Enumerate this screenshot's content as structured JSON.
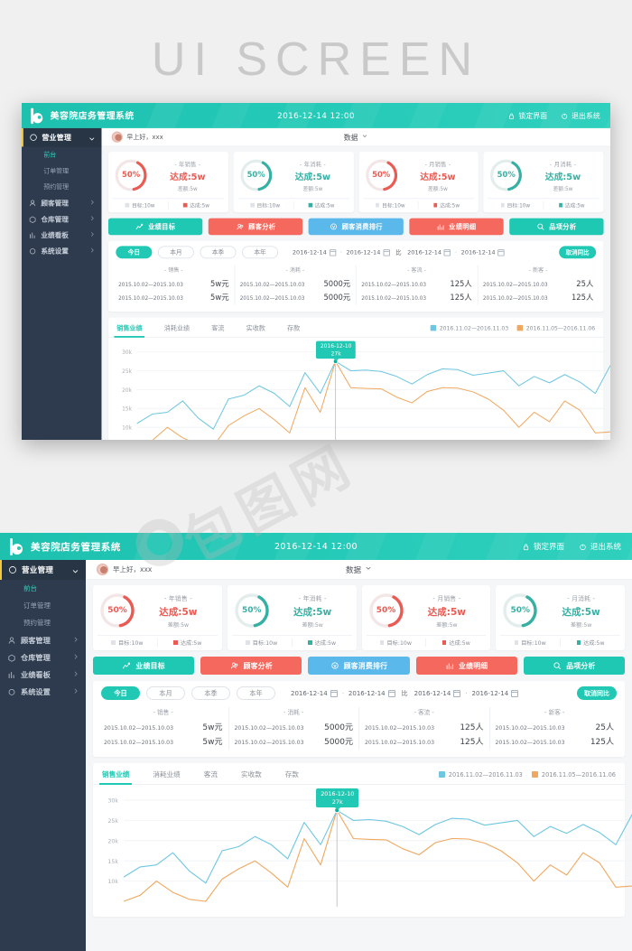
{
  "poster": {
    "heading": "UI SCREEN",
    "watermark": "包图网"
  },
  "topbar": {
    "app_title": "美容院店务管理系统",
    "clock": "2016-12-14 12:00",
    "lock_label": "锁定界面",
    "exit_label": "退出系统",
    "bg_color": "#23c8b6"
  },
  "sidebar": {
    "group": {
      "label": "营业管理",
      "icon": "compass-icon",
      "expanded": true,
      "accent": "#f5c842"
    },
    "sub_items": [
      {
        "label": "前台",
        "active": true
      },
      {
        "label": "订单管理",
        "active": false
      },
      {
        "label": "预约管理",
        "active": false
      }
    ],
    "items": [
      {
        "label": "顾客管理",
        "icon": "user-icon"
      },
      {
        "label": "仓库管理",
        "icon": "box-icon"
      },
      {
        "label": "业绩看板",
        "icon": "chart-icon"
      },
      {
        "label": "系统设置",
        "icon": "gear-icon"
      }
    ]
  },
  "greeting": {
    "text": "早上好，xxx",
    "data_dropdown": "数据"
  },
  "kpi_cards": [
    {
      "name": "- 年销售 -",
      "percent": "50%",
      "achieve_label": "达成:5w",
      "diff_label": "差额:5w",
      "target_label": "目标:10w",
      "foot_achieve_label": "达成:5w",
      "color": "#ea5b53",
      "ring_bg": "#f2e7e6",
      "value": 50
    },
    {
      "name": "- 年消耗 -",
      "percent": "50%",
      "achieve_label": "达成:5w",
      "diff_label": "差额:5w",
      "target_label": "目标:10w",
      "foot_achieve_label": "达成:5w",
      "color": "#37b0a4",
      "ring_bg": "#e3eeec",
      "value": 50
    },
    {
      "name": "- 月销售 -",
      "percent": "50%",
      "achieve_label": "达成:5w",
      "diff_label": "差额:5w",
      "target_label": "目标:10w",
      "foot_achieve_label": "达成:5w",
      "color": "#ea5b53",
      "ring_bg": "#f2e7e6",
      "value": 50
    },
    {
      "name": "- 月消耗 -",
      "percent": "50%",
      "achieve_label": "达成:5w",
      "diff_label": "差额:5w",
      "target_label": "目标:10w",
      "foot_achieve_label": "达成:5w",
      "color": "#37b0a4",
      "ring_bg": "#e3eeec",
      "value": 50
    }
  ],
  "action_buttons": [
    {
      "label": "业绩目标",
      "icon": "line-chart-icon",
      "color": "#1ec8b3"
    },
    {
      "label": "顾客分析",
      "icon": "people-icon",
      "color": "#f4685e"
    },
    {
      "label": "顾客消费排行",
      "icon": "medal-icon",
      "color": "#5bb8ea"
    },
    {
      "label": "业绩明细",
      "icon": "bar-chart-icon",
      "color": "#f4685e"
    },
    {
      "label": "品项分析",
      "icon": "search-icon",
      "color": "#1ec8b3"
    }
  ],
  "filters": {
    "pills": [
      {
        "label": "今日",
        "active": true
      },
      {
        "label": "本月",
        "active": false
      },
      {
        "label": "本季",
        "active": false
      },
      {
        "label": "本年",
        "active": false
      }
    ],
    "date_from_1": "2016-12-14",
    "date_to_1": "2016-12-14",
    "compare_label": "比",
    "date_from_2": "2016-12-14",
    "date_to_2": "2016-12-14",
    "separator": "·",
    "cancel_compare_label": "取消同比"
  },
  "stats": [
    {
      "title": "- 销售 -",
      "rows": [
        {
          "range": "2015.10.02—2015.10.03",
          "value": "5w元"
        },
        {
          "range": "2015.10.02—2015.10.03",
          "value": "5w元"
        }
      ]
    },
    {
      "title": "- 消耗 -",
      "rows": [
        {
          "range": "2015.10.02—2015.10.03",
          "value": "5000元"
        },
        {
          "range": "2015.10.02—2015.10.03",
          "value": "5000元"
        }
      ]
    },
    {
      "title": "- 客流 -",
      "rows": [
        {
          "range": "2015.10.02—2015.10.03",
          "value": "125人"
        },
        {
          "range": "2015.10.02—2015.10.03",
          "value": "125人"
        }
      ]
    },
    {
      "title": "- 新客 -",
      "rows": [
        {
          "range": "2015.10.02—2015.10.03",
          "value": "25人"
        },
        {
          "range": "2015.10.02—2015.10.03",
          "value": "125人"
        }
      ]
    }
  ],
  "chart_tabs": [
    {
      "label": "销售业绩",
      "active": true
    },
    {
      "label": "消耗业绩",
      "active": false
    },
    {
      "label": "客流",
      "active": false
    },
    {
      "label": "实收款",
      "active": false
    },
    {
      "label": "存款",
      "active": false
    }
  ],
  "chart_data": {
    "type": "line",
    "title": "销售业绩",
    "xlabel": "",
    "ylabel": "",
    "ylim": [
      5000,
      32000
    ],
    "grid": true,
    "legend_position": "top-right",
    "ytick_labels": [
      "10k",
      "15k",
      "20k",
      "25k",
      "30k"
    ],
    "ytick_values": [
      10000,
      15000,
      20000,
      25000,
      30000
    ],
    "legend": [
      {
        "name": "2016.11.02—2016.11.03",
        "color": "#6ec6e0"
      },
      {
        "name": "2016.11.05—2016.11.06",
        "color": "#f0a860"
      }
    ],
    "annotation": {
      "label": "2016-12-10",
      "value": "27k",
      "x_index": 13
    },
    "series": [
      {
        "name": "2016.11.02—2016.11.03",
        "color": "#6ec6e0",
        "values": [
          11000,
          13500,
          14000,
          17000,
          12500,
          9500,
          17500,
          18500,
          21000,
          19000,
          15500,
          24500,
          19000,
          27500,
          25000,
          25200,
          24800,
          23500,
          21500,
          24000,
          25500,
          25300,
          23800,
          24400,
          25000,
          21000,
          23500,
          21800,
          24000,
          22000,
          19000,
          26500,
          30500,
          27000,
          24500,
          24000
        ]
      },
      {
        "name": "2016.11.05—2016.11.06",
        "color": "#f0a860",
        "values": [
          5000,
          6500,
          10000,
          7200,
          5500,
          5000,
          10500,
          13000,
          15000,
          12000,
          8500,
          20500,
          14000,
          27500,
          20500,
          20300,
          20200,
          18000,
          16500,
          19500,
          20500,
          20400,
          19400,
          17500,
          14500,
          10000,
          14000,
          11500,
          17000,
          14500,
          8500,
          8800,
          19000,
          25500,
          20500,
          19200
        ]
      }
    ]
  }
}
